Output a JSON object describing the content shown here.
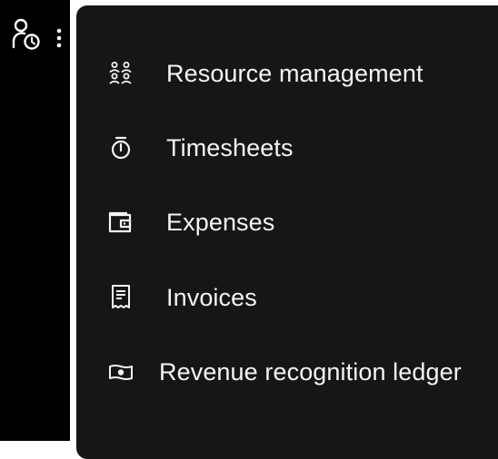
{
  "rail": {
    "icons": [
      "user-clock-icon",
      "overflow-menu-icon"
    ]
  },
  "menu": {
    "items": [
      {
        "label": "Resource management",
        "icon": "people-group-icon"
      },
      {
        "label": "Timesheets",
        "icon": "stopwatch-icon"
      },
      {
        "label": "Expenses",
        "icon": "wallet-icon"
      },
      {
        "label": "Invoices",
        "icon": "receipt-icon"
      },
      {
        "label": "Revenue recognition ledger",
        "icon": "money-icon"
      }
    ]
  },
  "colors": {
    "rail_bg": "#000000",
    "menu_bg": "#161616",
    "text": "#f4f4f4"
  }
}
